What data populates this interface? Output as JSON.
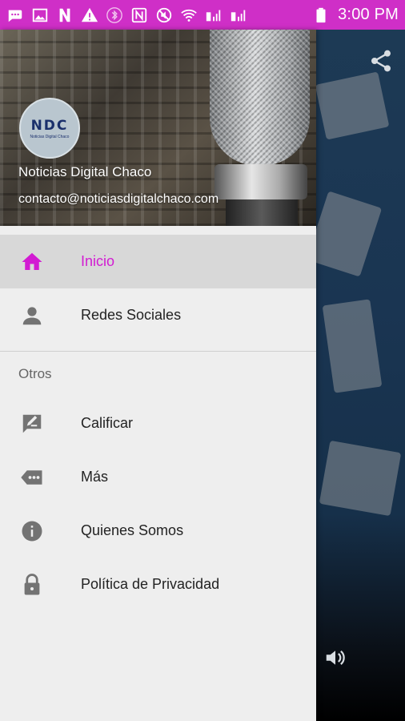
{
  "status_bar": {
    "time": "3:00 PM",
    "icons": [
      "message-icon",
      "image-icon",
      "n-icon",
      "warning-icon",
      "bluetooth-icon",
      "nfc-icon",
      "no-sound-icon",
      "wifi-icon",
      "signal-1-icon",
      "signal-2-icon",
      "battery-icon"
    ]
  },
  "drawer": {
    "header": {
      "avatar_text": "NDC",
      "avatar_subtext": "Noticias Digital Chaco",
      "name": "Noticias Digital Chaco",
      "email": "contacto@noticiasdigitalchaco.com"
    },
    "items_primary": [
      {
        "label": "Inicio",
        "icon": "home-icon",
        "active": true
      },
      {
        "label": "Redes Sociales",
        "icon": "person-icon",
        "active": false
      }
    ],
    "section_title": "Otros",
    "items_secondary": [
      {
        "label": "Calificar",
        "icon": "rate-review-icon"
      },
      {
        "label": "Más",
        "icon": "more-icon"
      },
      {
        "label": "Quienes Somos",
        "icon": "info-icon"
      },
      {
        "label": "Política de Privacidad",
        "icon": "lock-icon"
      }
    ]
  },
  "colors": {
    "accent": "#d21bd2",
    "status_bar": "#cf2fc7"
  }
}
